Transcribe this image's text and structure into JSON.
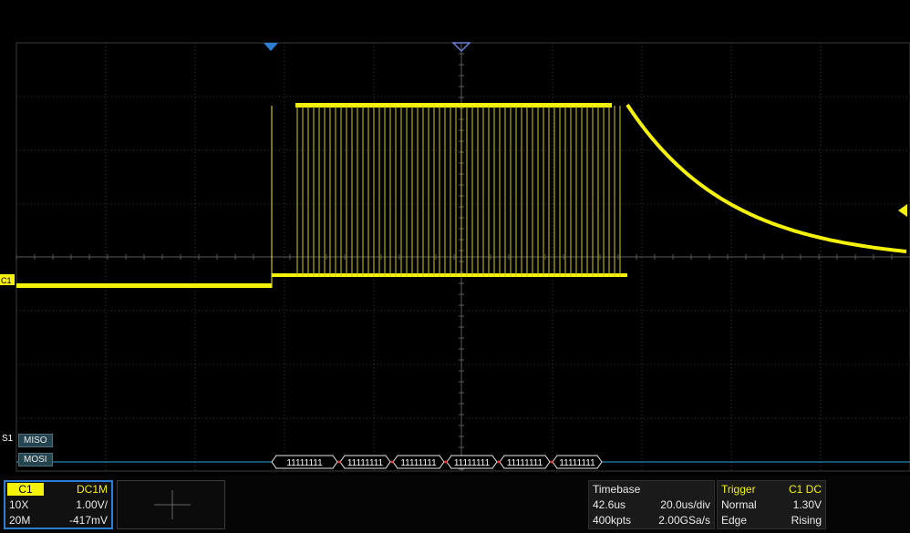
{
  "channel_marker": "C1",
  "bus_label": "S1",
  "miso_label": "MISO",
  "mosi_label": "MOSI",
  "decode_values": [
    "11111111",
    "11111111",
    "11111111",
    "11111111",
    "11111111",
    "11111111"
  ],
  "colors": {
    "trace": "#f4f20a",
    "grid": "#3a3a3a",
    "bus": "#2aa7e0",
    "marker": "#2a7fd4",
    "trigger_marker": "#f4f20a"
  },
  "channel_panel": {
    "name": "C1",
    "coupling": "DC1M",
    "probe": "10X",
    "scale": "1.00V/",
    "bandwidth": "20M",
    "offset": "-417mV"
  },
  "timebase_panel": {
    "title": "Timebase",
    "delay": "42.6us",
    "scale": "20.0us/div",
    "points": "400kpts",
    "sample_rate": "2.00GSa/s"
  },
  "trigger_panel": {
    "title": "Trigger",
    "source": "C1 DC",
    "mode": "Normal",
    "level": "1.30V",
    "type": "Edge",
    "slope": "Rising"
  }
}
